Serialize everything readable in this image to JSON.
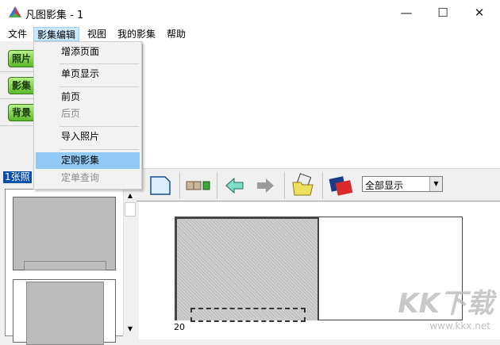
{
  "window": {
    "title": "凡图影集 - 1",
    "minimize": "—",
    "maximize": "☐",
    "close": "✕"
  },
  "menubar": [
    "文件",
    "影集编辑",
    "视图",
    "我的影集",
    "帮助"
  ],
  "side_buttons": [
    "照片",
    "影集",
    "背景"
  ],
  "edit_menu": [
    {
      "label": "增添页面",
      "enabled": true
    },
    {
      "label": "单页显示",
      "enabled": true
    },
    {
      "label": "前页",
      "enabled": true
    },
    {
      "label": "后页",
      "enabled": false
    },
    {
      "label": "导入照片",
      "enabled": true
    },
    {
      "label": "定购影集",
      "enabled": true,
      "highlighted": true
    },
    {
      "label": "定单查询",
      "enabled": false
    }
  ],
  "photo_count_label": "1张照",
  "toolbar": {
    "view_select": "全部显示"
  },
  "canvas": {
    "page_number": "20"
  },
  "watermark": {
    "logo": "KK下载",
    "url": "www.kkx.net"
  }
}
